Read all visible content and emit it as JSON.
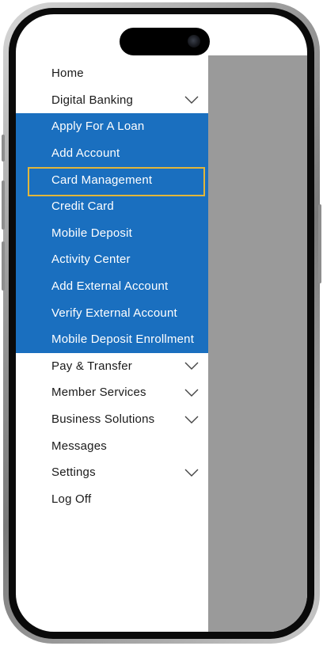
{
  "menu": {
    "home": "Home",
    "digital_banking": {
      "label": "Digital Banking",
      "items": [
        "Apply For A Loan",
        "Add Account",
        "Card Management",
        "Credit Card",
        "Mobile Deposit",
        "Activity Center",
        "Add External Account",
        "Verify External Account",
        "Mobile Deposit Enrollment"
      ],
      "active_item": "Card Management"
    },
    "pay_transfer": "Pay & Transfer",
    "member_services": "Member Services",
    "business_solutions": "Business Solutions",
    "messages": "Messages",
    "settings": "Settings",
    "log_off": "Log Off"
  },
  "colors": {
    "submenu_background": "#1a6fbf",
    "active_highlight_border": "#e2b63a",
    "overlay": "#9a9a9a"
  }
}
